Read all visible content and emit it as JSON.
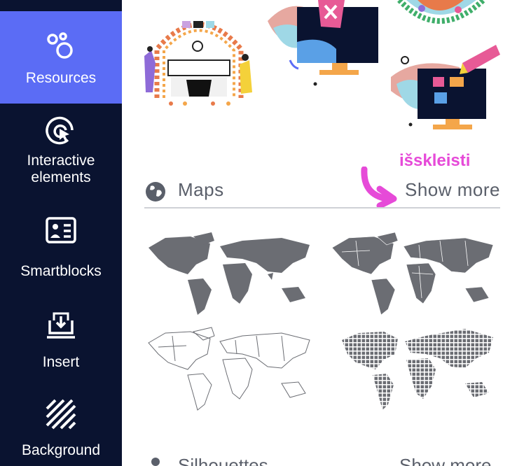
{
  "sidebar": {
    "items": [
      {
        "label": "Resources",
        "icon": "bubbles-icon",
        "active": true
      },
      {
        "label": "Interactive elements",
        "icon": "cursor-click-icon",
        "active": false
      },
      {
        "label": "Smartblocks",
        "icon": "smartblock-card-icon",
        "active": false
      },
      {
        "label": "Insert",
        "icon": "insert-tray-icon",
        "active": false
      },
      {
        "label": "Background",
        "icon": "diagonal-stripes-icon",
        "active": false
      }
    ]
  },
  "section": {
    "title": "Maps",
    "icon": "globe-icon",
    "show_more": "Show more",
    "annotation": "išskleisti"
  },
  "maps": [
    {
      "name": "world-map-filled"
    },
    {
      "name": "world-map-countries"
    },
    {
      "name": "world-map-outline"
    },
    {
      "name": "world-map-dotted"
    }
  ],
  "next_section": {
    "title_partial": "Silhouettes",
    "show_more_partial": "Show more"
  },
  "colors": {
    "sidebar_bg": "#0a1330",
    "active_bg": "#5b6cf5",
    "annotation": "#e64ad8",
    "map_fill": "#6b6d73"
  }
}
